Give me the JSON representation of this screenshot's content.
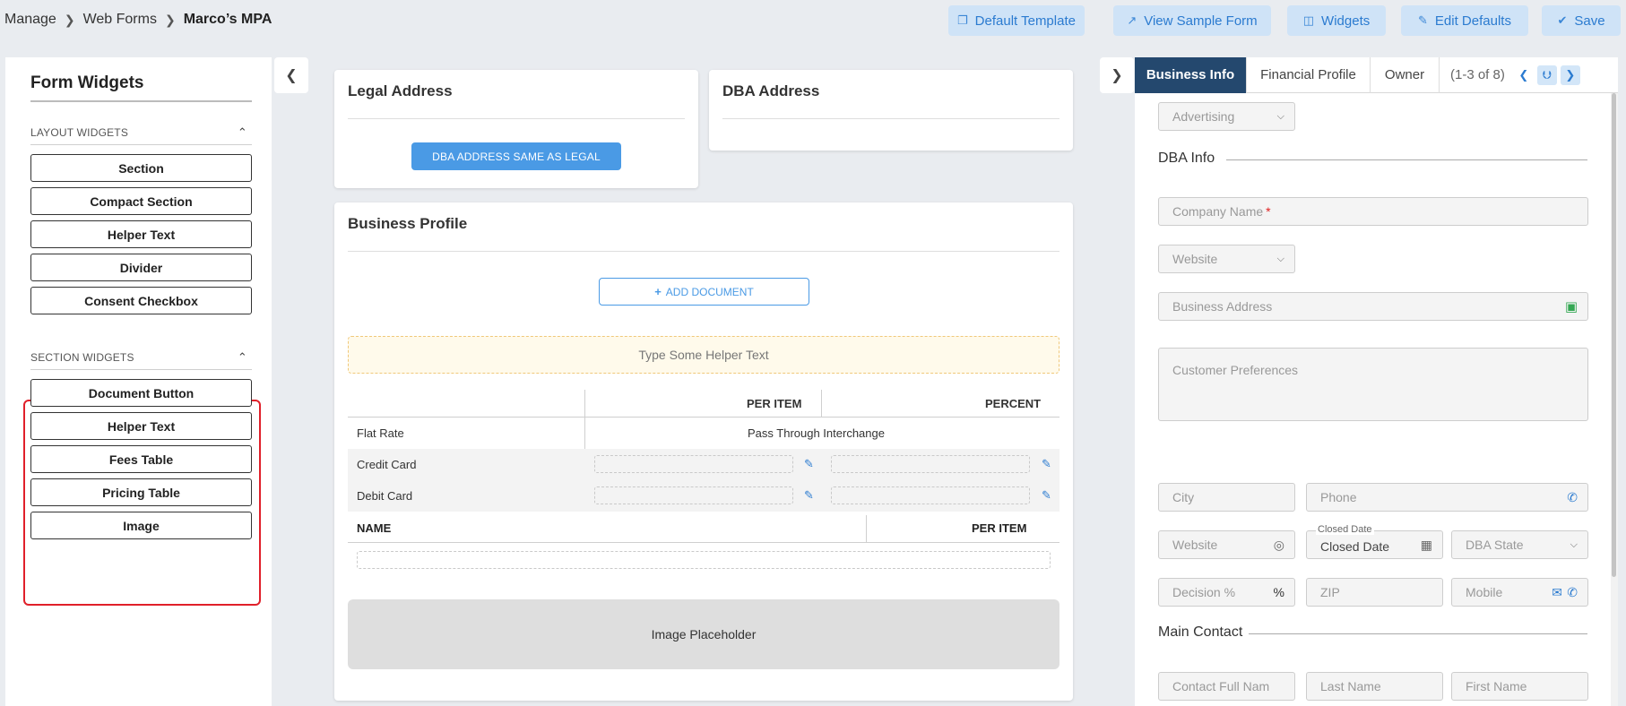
{
  "breadcrumb": {
    "items": [
      "Manage",
      "Web Forms"
    ],
    "current": "Marco’s MPA"
  },
  "toolbar": {
    "default_template": "Default Template",
    "view_sample_form": "View Sample Form",
    "widgets": "Widgets",
    "edit_defaults": "Edit Defaults",
    "save": "Save"
  },
  "left_panel": {
    "title": "Form Widgets",
    "layout_group": {
      "title": "LAYOUT WIDGETS",
      "items": [
        "Section",
        "Compact Section",
        "Helper Text",
        "Divider",
        "Consent Checkbox"
      ]
    },
    "section_group": {
      "title": "SECTION WIDGETS",
      "items": [
        "Document Button",
        "Helper Text",
        "Fees Table",
        "Pricing Table",
        "Image"
      ]
    }
  },
  "legal_address": {
    "title": "Legal Address",
    "button": "DBA ADDRESS SAME AS LEGAL"
  },
  "dba_address": {
    "title": "DBA Address"
  },
  "business_profile": {
    "title": "Business Profile",
    "add_document": "ADD DOCUMENT",
    "helper_text": "Type Some Helper Text",
    "fees_table": {
      "col_per_item": "PER ITEM",
      "col_percent": "PERCENT",
      "rows": [
        {
          "label": "Flat Rate",
          "value": "Pass Through Interchange"
        },
        {
          "label": "Credit Card"
        },
        {
          "label": "Debit Card"
        }
      ]
    },
    "pricing_table": {
      "col_name": "NAME",
      "col_per_item": "PER ITEM"
    },
    "image_placeholder": "Image Placeholder"
  },
  "right_panel": {
    "tabs": [
      "Business Info",
      "Financial Profile",
      "Owner"
    ],
    "active_tab": "Business Info",
    "count": "(1-3 of 8)",
    "industry_select": "Advertising",
    "dba_info_title": "DBA Info",
    "company_name": "Company Name",
    "website_select": "Website",
    "business_address": "Business Address",
    "customer_preferences": "Customer Preferences",
    "city": "City",
    "phone": "Phone",
    "website": "Website",
    "closed_date_label": "Closed Date",
    "closed_date": "Closed Date",
    "dba_state": "DBA State",
    "decision": "Decision %",
    "zip": "ZIP",
    "mobile": "Mobile",
    "main_contact_title": "Main Contact",
    "contact_full_name": "Contact Full Nam",
    "last_name": "Last Name",
    "first_name": "First Name"
  }
}
